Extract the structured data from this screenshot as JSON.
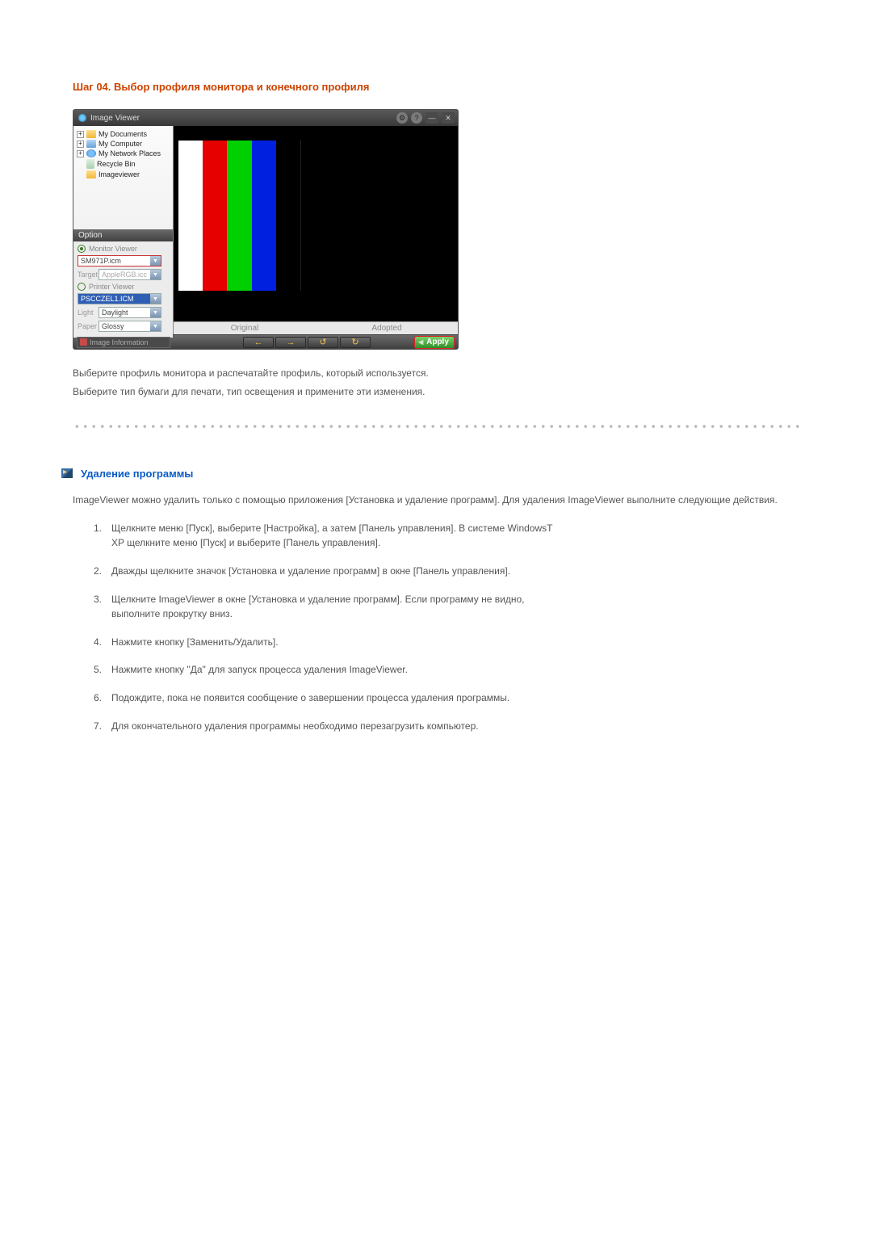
{
  "step_title": "Шаг 04. Выбор профиля монитора и конечного профиля",
  "viewer": {
    "title": "Image Viewer",
    "tree": [
      {
        "exp": "+",
        "icon": "folder",
        "label": "My Documents"
      },
      {
        "exp": "+",
        "icon": "comp",
        "label": "My Computer"
      },
      {
        "exp": "+",
        "icon": "net",
        "label": "My Network Places"
      },
      {
        "exp": "",
        "icon": "bin",
        "label": "Recycle Bin"
      },
      {
        "exp": "",
        "icon": "folder",
        "label": "Imageviewer"
      }
    ],
    "option_header": "Option",
    "monitor_label": "Monitor Viewer",
    "monitor_profile": "SM971P.icm",
    "target_label": "Target",
    "target_value": "AppleRGB.icc",
    "printer_label": "Printer Viewer",
    "printer_value": "PSCCZEL1.ICM",
    "light_label": "Light",
    "light_value": "Daylight",
    "paper_label": "Paper",
    "paper_value": "Glossy",
    "original": "Original",
    "adopted": "Adopted",
    "img_info": "Image Information",
    "apply": "Apply"
  },
  "desc_line1": "Выберите профиль монитора и распечатайте профиль, который используется.",
  "desc_line2": "Выберите тип бумаги для печати, тип освещения и примените эти изменения.",
  "uninstall": {
    "title": "Удаление программы",
    "intro": "ImageViewer можно удалить только с помощью приложения [Установка и удаление программ]. Для удаления ImageViewer выполните следующие действия.",
    "steps": [
      "Щелкните меню [Пуск], выберите [Настройка], а затем [Панель управления]. В системе WindowsТ XP щелкните меню [Пуск] и выберите [Панель управления].",
      "Дважды щелкните значок [Установка и удаление программ] в окне [Панель управления].",
      "Щелкните ImageViewer в окне [Установка и удаление программ]. Если программу не видно, выполните прокрутку вниз.",
      "Нажмите кнопку [Заменить/Удалить].",
      "Нажмите кнопку \"Да\" для запуск процесса удаления ImageViewer.",
      "Подождите, пока не появится сообщение о завершении процесса удаления программы.",
      "Для окончательного удаления программы необходимо перезагрузить компьютер."
    ]
  }
}
